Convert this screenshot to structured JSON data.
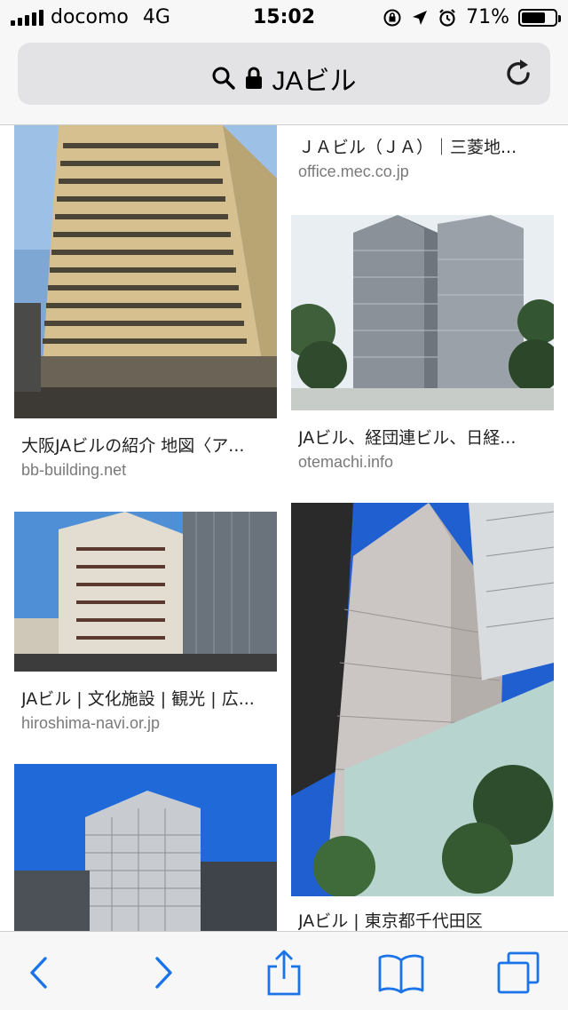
{
  "status_bar": {
    "carrier": "docomo",
    "network": "4G",
    "time": "15:02",
    "battery": "71%",
    "battery_level": 0.71
  },
  "address_bar": {
    "query": "JAビル"
  },
  "results": [
    {
      "title": "",
      "site": "",
      "icon": "building-photo"
    },
    {
      "title": "ＪＡビル（ＪＡ）｜三菱地...",
      "site": "office.mec.co.jp",
      "icon": "no-image"
    },
    {
      "title": "大阪JAビルの紹介 地図〈ア...",
      "site": "bb-building.net",
      "icon": "building-photo"
    },
    {
      "title": "JAビル、経団連ビル、日経...",
      "site": "otemachi.info",
      "icon": "building-photo"
    },
    {
      "title": "JAビル | 文化施設 | 観光 | 広...",
      "site": "hiroshima-navi.or.jp",
      "icon": "building-photo"
    },
    {
      "title": "JAビル | 東京都千代田区",
      "site": "",
      "icon": "building-photo"
    },
    {
      "title": "",
      "site": "",
      "icon": "building-photo"
    }
  ],
  "colors": {
    "accent": "#1a73e8",
    "toolbar_bg": "#f7f7f7",
    "field_bg": "#e3e3e6",
    "site_gray": "#7a7a7a"
  },
  "toolbar": {
    "icons": [
      "back-icon",
      "forward-icon",
      "share-icon",
      "bookmarks-icon",
      "tabs-icon"
    ]
  }
}
